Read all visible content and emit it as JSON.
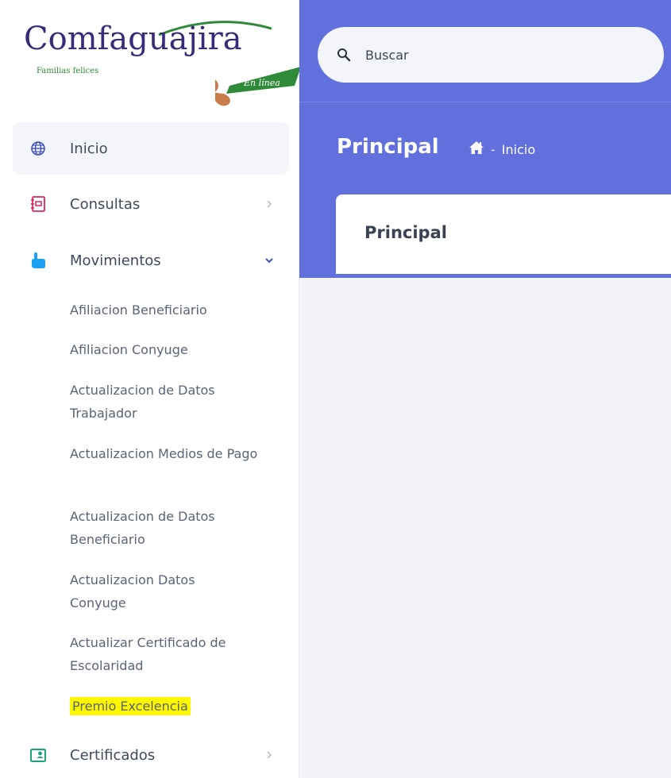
{
  "brand": {
    "name": "Comfaguajira",
    "tagline": "Familias felices",
    "badge": "En línea"
  },
  "search": {
    "placeholder": "Buscar"
  },
  "header": {
    "title": "Principal",
    "breadcrumb": {
      "separator": "-",
      "current": "Inicio"
    }
  },
  "card": {
    "title": "Principal"
  },
  "sidebar": {
    "items": [
      {
        "label": "Inicio",
        "icon": "globe-icon"
      },
      {
        "label": "Consultas",
        "icon": "notebook-icon"
      },
      {
        "label": "Movimientos",
        "icon": "hand-pointer-icon"
      },
      {
        "label": "Certificados",
        "icon": "id-card-icon"
      }
    ],
    "submenu": [
      "Afiliacion Beneficiario",
      "Afiliacion Conyuge",
      "Actualizacion de Datos Trabajador",
      "Actualizacion Medios de Pago",
      "Actualizacion de Datos Beneficiario",
      "Actualizacion Datos Conyuge",
      "Actualizar Certificado de Escolaridad",
      "Premio Excelencia"
    ]
  },
  "colors": {
    "header_bg": "#6270de",
    "highlight": "#fff700",
    "brand_purple": "#3a2a7a",
    "brand_green": "#2f8a3a"
  }
}
